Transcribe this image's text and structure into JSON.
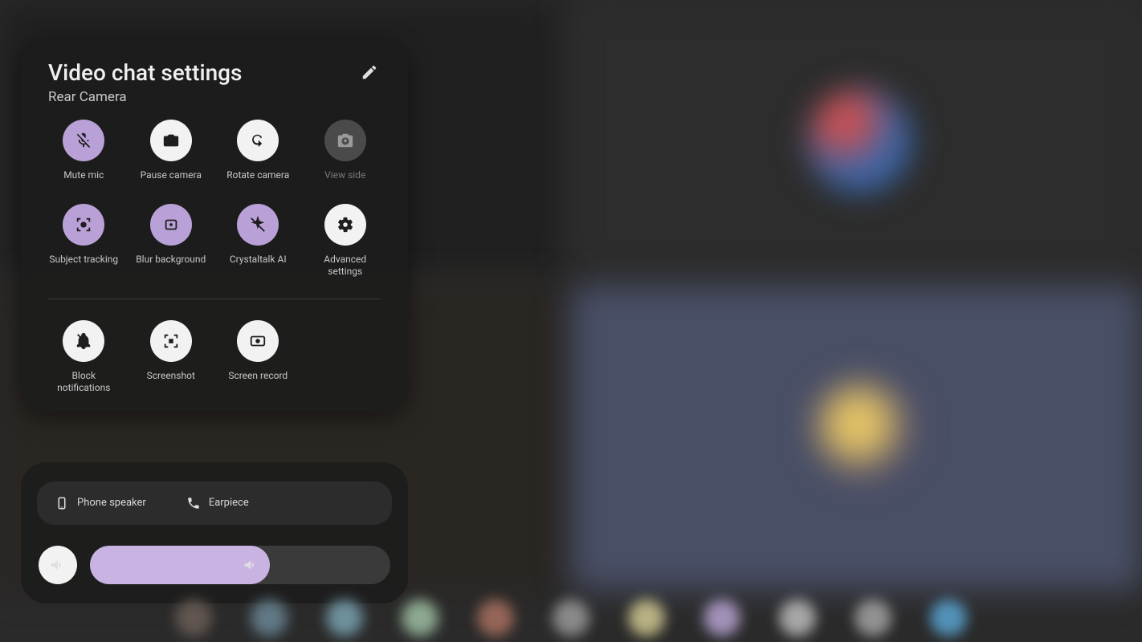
{
  "panel": {
    "title": "Video chat settings",
    "subtitle": "Rear Camera",
    "edit_icon": "pencil"
  },
  "controls_row1": [
    {
      "id": "mute-mic",
      "icon": "mic-off",
      "circle": "purple",
      "label": "Mute mic",
      "disabled": false
    },
    {
      "id": "pause-camera",
      "icon": "camera",
      "circle": "white",
      "label": "Pause camera",
      "disabled": false
    },
    {
      "id": "rotate-camera",
      "icon": "rotate",
      "circle": "white",
      "label": "Rotate camera",
      "disabled": false
    },
    {
      "id": "view-side",
      "icon": "camera-swap",
      "circle": "dim",
      "label": "View side",
      "disabled": true
    }
  ],
  "controls_row2": [
    {
      "id": "subject-tracking",
      "icon": "subject",
      "circle": "purple",
      "label": "Subject tracking",
      "disabled": false
    },
    {
      "id": "blur-background",
      "icon": "blur",
      "circle": "purple",
      "label": "Blur background",
      "disabled": false
    },
    {
      "id": "crystaltalk-ai",
      "icon": "sparkle-off",
      "circle": "purple",
      "label": "Crystaltalk AI",
      "disabled": false
    },
    {
      "id": "advanced",
      "icon": "gear",
      "circle": "white",
      "label": "Advanced settings",
      "disabled": false
    }
  ],
  "controls_row3": [
    {
      "id": "block-notifs",
      "icon": "bell-off",
      "circle": "white",
      "label": "Block notifications",
      "disabled": false
    },
    {
      "id": "screenshot",
      "icon": "screenshot",
      "circle": "white",
      "label": "Screenshot",
      "disabled": false
    },
    {
      "id": "screen-record",
      "icon": "record",
      "circle": "white",
      "label": "Screen record",
      "disabled": false
    }
  ],
  "audio": {
    "options": [
      {
        "id": "phone-speaker",
        "icon": "phone-speaker",
        "label": "Phone speaker"
      },
      {
        "id": "earpiece",
        "icon": "phone",
        "label": "Earpiece"
      }
    ],
    "volume_percent": 60
  },
  "dock_colors": [
    "#6b5f57",
    "#6b8796",
    "#7aa3b1",
    "#9fbfa3",
    "#a97060",
    "#9a9a9a",
    "#d1c892",
    "#b6a3d1",
    "#bcbcbc",
    "#a4a4a4",
    "#5aa3d1"
  ]
}
